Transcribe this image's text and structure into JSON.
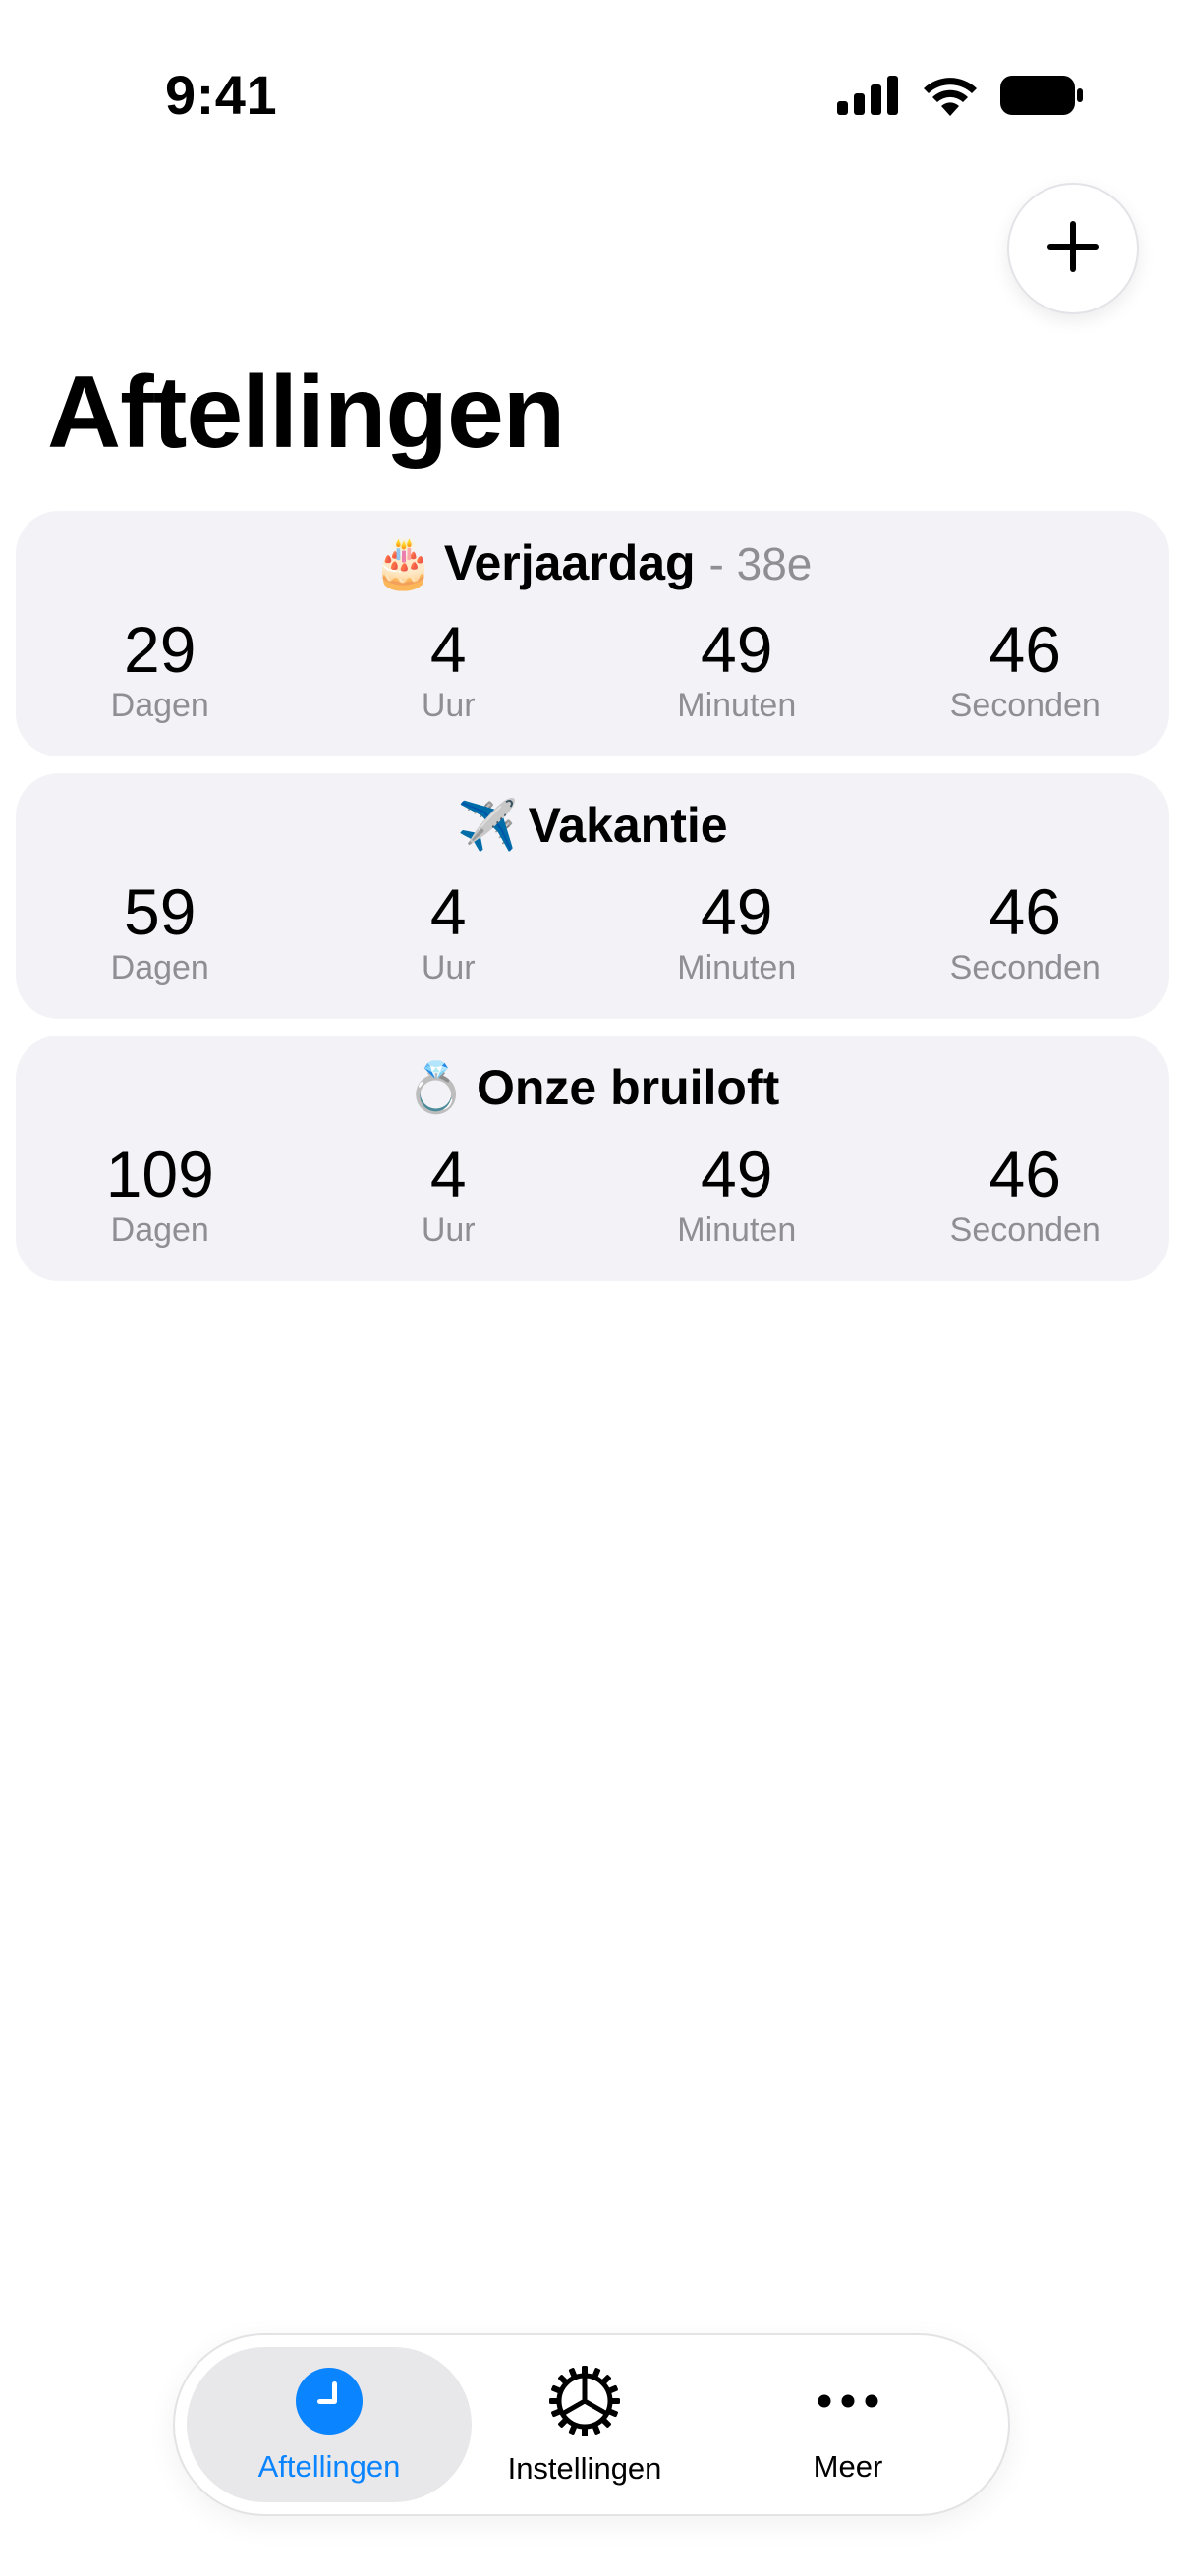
{
  "status_bar": {
    "time": "9:41",
    "icons": [
      "cellular-signal-icon",
      "wifi-icon",
      "battery-icon"
    ]
  },
  "header": {
    "add_button_icon": "plus-icon",
    "title": "Aftellingen"
  },
  "countdowns": [
    {
      "emoji": "🎂",
      "title": "Verjaardag",
      "subtitle": "- 38e",
      "units": [
        {
          "value": "29",
          "label": "Dagen"
        },
        {
          "value": "4",
          "label": "Uur"
        },
        {
          "value": "49",
          "label": "Minuten"
        },
        {
          "value": "46",
          "label": "Seconden"
        }
      ]
    },
    {
      "emoji": "✈️",
      "title": "Vakantie",
      "subtitle": "",
      "units": [
        {
          "value": "59",
          "label": "Dagen"
        },
        {
          "value": "4",
          "label": "Uur"
        },
        {
          "value": "49",
          "label": "Minuten"
        },
        {
          "value": "46",
          "label": "Seconden"
        }
      ]
    },
    {
      "emoji": "💍",
      "title": "Onze bruiloft",
      "subtitle": "",
      "units": [
        {
          "value": "109",
          "label": "Dagen"
        },
        {
          "value": "4",
          "label": "Uur"
        },
        {
          "value": "49",
          "label": "Minuten"
        },
        {
          "value": "46",
          "label": "Seconden"
        }
      ]
    }
  ],
  "tab_bar": {
    "tabs": [
      {
        "label": "Aftellingen",
        "icon": "clock-icon",
        "active": true
      },
      {
        "label": "Instellingen",
        "icon": "gear-icon",
        "active": false
      },
      {
        "label": "Meer",
        "icon": "more-icon",
        "active": false
      }
    ]
  },
  "colors": {
    "accent": "#0a84ff",
    "card_background": "#f2f2f7",
    "secondary_text": "#8e8e93"
  }
}
